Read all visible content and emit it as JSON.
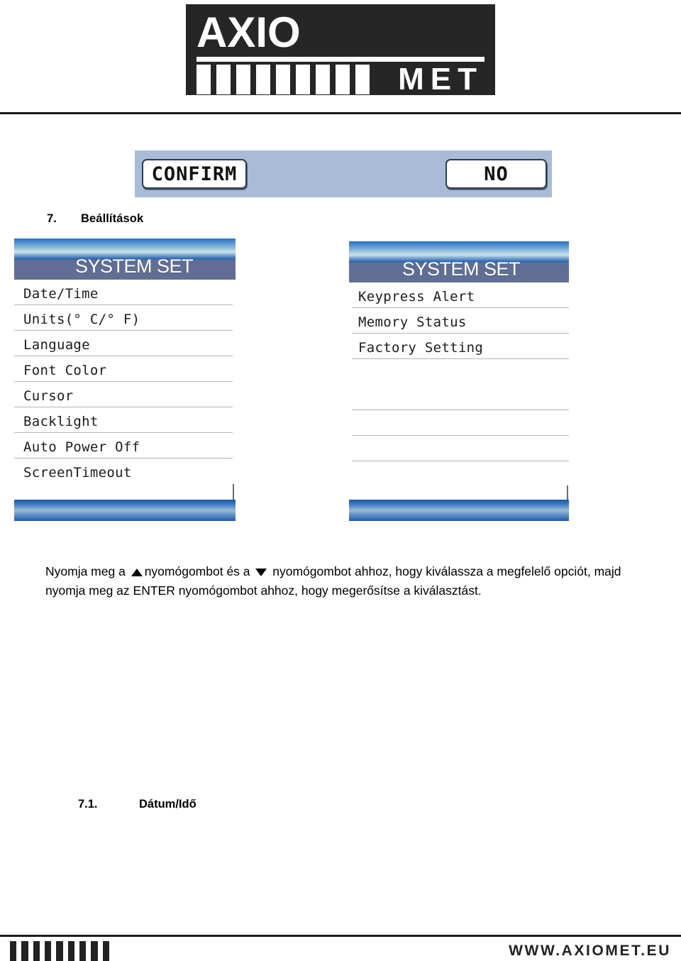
{
  "brand": {
    "logo_top": "AXIO",
    "logo_bottom": "MET",
    "logo_bar_count": 9,
    "footer_url": "WWW.AXIOMET.EU",
    "footer_bar_count": 9
  },
  "lcd_dialog": {
    "confirm_label": "CONFIRM",
    "no_label": "NO",
    "background_color": "#a8bcd8"
  },
  "section": {
    "number": "7.",
    "title": "Beállítások"
  },
  "subsection": {
    "number": "7.1.",
    "title": "Dátum/Idő"
  },
  "screens": {
    "left": {
      "header_title": "SYSTEM SET",
      "items": [
        "Date/Time",
        "Units(° C/° F)",
        "Language",
        "Font Color",
        "Cursor",
        "Backlight",
        "Auto Power Off",
        "ScreenTimeout"
      ]
    },
    "right": {
      "header_title": "SYSTEM SET",
      "items": [
        "Keypress Alert",
        "Memory Status",
        "Factory Setting",
        "",
        "",
        "",
        "",
        ""
      ]
    }
  },
  "instructions": {
    "part1": "Nyomja meg a",
    "part2": "nyomógombot és a",
    "part3": "nyomógombot ahhoz, hogy kiválassza a megfelelő opciót, majd nyomja meg az ENTER nyomógombot ahhoz, hogy megerősítse a kiválasztást.",
    "up_icon": "triangle-up-icon",
    "down_icon": "triangle-down-icon"
  }
}
